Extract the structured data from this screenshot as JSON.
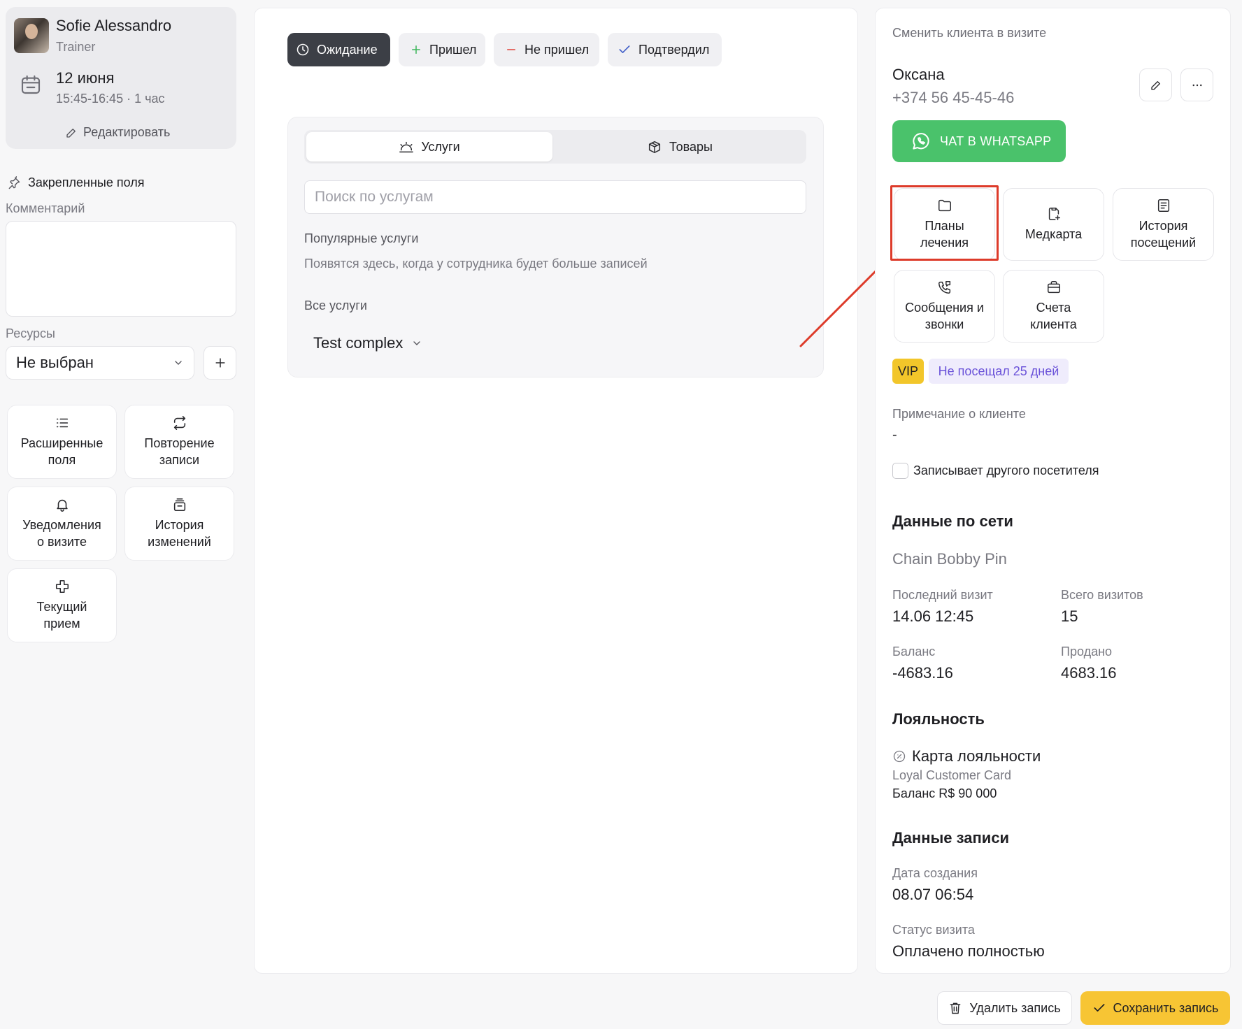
{
  "user": {
    "name": "Sofie Alessandro",
    "role": "Trainer",
    "date": "12 июня",
    "time": "15:45-16:45 · 1 час",
    "edit_label": "Редактировать"
  },
  "left": {
    "pinned_label": "Закрепленные поля",
    "comment_label": "Комментарий",
    "resources_label": "Ресурсы",
    "resources_value": "Не выбран",
    "tiles": [
      {
        "label_1": "Расширенные",
        "label_2": "поля",
        "icon": "list-icon"
      },
      {
        "label_1": "Повторение",
        "label_2": "записи",
        "icon": "repeat-icon"
      },
      {
        "label_1": "Уведомления",
        "label_2": "о визите",
        "icon": "bell-icon"
      },
      {
        "label_1": "История",
        "label_2": "изменений",
        "icon": "history-icon"
      },
      {
        "label_1": "Текущий",
        "label_2": "прием",
        "icon": "medical-cross-icon"
      }
    ]
  },
  "status_buttons": [
    {
      "label": "Ожидание",
      "icon": "clock-icon",
      "active": true
    },
    {
      "label": "Пришел",
      "icon": "plus-icon",
      "color": "#3cb55a"
    },
    {
      "label": "Не пришел",
      "icon": "minus-icon",
      "color": "#e0433a"
    },
    {
      "label": "Подтвердил",
      "icon": "check-icon",
      "color": "#4361c9"
    }
  ],
  "services": {
    "tab_services": "Услуги",
    "tab_goods": "Товары",
    "search_placeholder": "Поиск по услугам",
    "popular_title": "Популярные услуги",
    "popular_empty": "Появятся здесь, когда у сотрудника будет больше записей",
    "all_title": "Все услуги",
    "group_name": "Test complex"
  },
  "client": {
    "change_label": "Сменить клиента в визите",
    "name": "Оксана",
    "phone": "+374 56 45-45-46",
    "whatsapp_label": "ЧАТ В WHATSAPP",
    "tiles": [
      {
        "label_1": "Планы",
        "label_2": "лечения",
        "icon": "folder-icon"
      },
      {
        "label_1": "Медкарта",
        "label_2": "",
        "icon": "medcard-icon"
      },
      {
        "label_1": "История",
        "label_2": "посещений",
        "icon": "visits-history-icon"
      },
      {
        "label_1": "Сообщения и",
        "label_2": "звонки",
        "icon": "messages-calls-icon"
      },
      {
        "label_1": "Счета",
        "label_2": "клиента",
        "icon": "wallet-icon"
      }
    ],
    "vip": "VIP",
    "visit_badge": "Не посещал 25 дней",
    "note_label": "Примечание о клиенте",
    "note_value": "-",
    "other_visitor_label": "Записывает другого посетителя"
  },
  "network": {
    "title": "Данные по сети",
    "chain": "Chain Bobby Pin",
    "last_visit_label": "Последний визит",
    "last_visit": "14.06 12:45",
    "total_visits_label": "Всего визитов",
    "total_visits": "15",
    "balance_label": "Баланс",
    "balance": "-4683.16",
    "sold_label": "Продано",
    "sold": "4683.16"
  },
  "loyalty": {
    "title": "Лояльность",
    "card_label": "Карта лояльности",
    "card_name": "Loyal Customer Card",
    "card_balance": "Баланс R$ 90 000"
  },
  "record": {
    "title": "Данные записи",
    "created_label": "Дата создания",
    "created": "08.07 06:54",
    "status_label": "Статус визита",
    "status": "Оплачено полностью"
  },
  "footer": {
    "delete_label": "Удалить запись",
    "save_label": "Сохранить запись"
  },
  "colors": {
    "whatsapp": "#4ac26b",
    "save": "#f7c534",
    "vip": "#f2c62a",
    "highlight": "#dd3b2a",
    "visit_badge_text": "#6a52d9"
  }
}
